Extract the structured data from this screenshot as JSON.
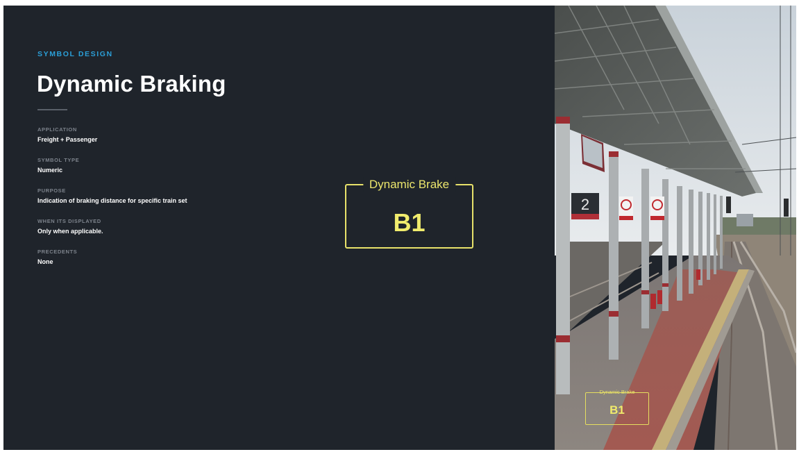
{
  "slide": {
    "eyebrow": "SYMBOL DESIGN",
    "title": "Dynamic Braking",
    "fields": [
      {
        "label": "APPLICATION",
        "value": "Freight + Passenger"
      },
      {
        "label": "SYMBOL TYPE",
        "value": "Numeric"
      },
      {
        "label": "PURPOSE",
        "value": "Indication of braking distance for specific train set"
      },
      {
        "label": "WHEN ITS DISPLAYED",
        "value": "Only when applicable."
      },
      {
        "label": "PRECEDENTS",
        "value": "None"
      }
    ]
  },
  "symbol": {
    "label": "Dynamic Brake",
    "code": "B1",
    "color": "#ece66c"
  },
  "photo": {
    "platform_sign_number": "2",
    "overlay_label": "Dynamic Brake",
    "overlay_code": "B1"
  },
  "colors": {
    "background": "#1f242b",
    "accent": "#2b9fd8",
    "symbol": "#ece66c"
  }
}
